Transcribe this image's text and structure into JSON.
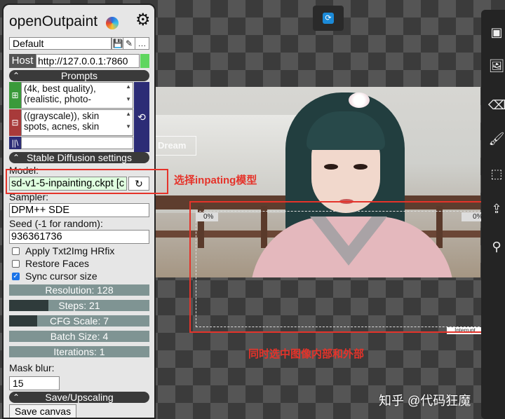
{
  "app": {
    "title": "openOutpaint",
    "profile_value": "Default",
    "host_label": "Host",
    "host_value": "http://127.0.0.1:7860",
    "host_status_color": "#5ed65e"
  },
  "prompts": {
    "section_label": "Prompts",
    "positive_text": "(4k, best quality), (realistic, photo-",
    "negative_text": "((grayscale)), skin spots, acnes, skin",
    "add_icon": "plus-icon",
    "remove_icon": "minus-icon",
    "history_icon": "history-icon",
    "styles_icon": "library-icon"
  },
  "sd": {
    "section_label": "Stable Diffusion settings",
    "model_label": "Model:",
    "model_value": "sd-v1-5-inpainting.ckpt [c",
    "sampler_label": "Sampler:",
    "sampler_value": "DPM++ SDE",
    "seed_label": "Seed (-1 for random):",
    "seed_value": "936361736",
    "checkboxes": [
      {
        "label": "Apply Txt2Img HRfix",
        "checked": false
      },
      {
        "label": "Restore Faces",
        "checked": false
      },
      {
        "label": "Sync cursor size",
        "checked": true
      }
    ],
    "sliders": [
      {
        "label": "Resolution: 128",
        "fraction": 0.0
      },
      {
        "label": "Steps: 21",
        "fraction": 0.28
      },
      {
        "label": "CFG Scale: 7",
        "fraction": 0.2
      },
      {
        "label": "Batch Size: 4",
        "fraction": 0.0
      },
      {
        "label": "Iterations: 1",
        "fraction": 0.0
      }
    ],
    "mask_blur_label": "Mask blur:",
    "mask_blur_value": "15"
  },
  "save": {
    "section_label": "Save/Upscaling",
    "save_canvas_label": "Save canvas"
  },
  "canvas": {
    "watermark": "Dream",
    "progress_left": "0%",
    "progress_right": "0%",
    "interrupt_label": "Interrupt"
  },
  "annotations": {
    "model_note": "选择inpating模型",
    "selection_note": "同时选中图像内部和外部",
    "red_color": "#e5332a"
  },
  "footer": {
    "watermark": "知乎 @代码狂魔"
  }
}
